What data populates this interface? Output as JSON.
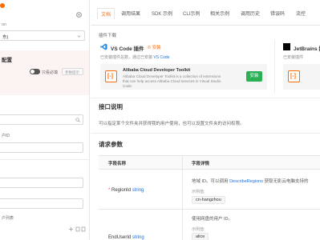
{
  "left": {
    "line1": "on",
    "select_value": "东)",
    "section_title": "配置",
    "toggle_label": "只看必填",
    "small_btn": "参数提示",
    "uid_label": "户ID",
    "list_label": "户列表"
  },
  "tabs": [
    "文档",
    "调用结果",
    "SDK 示例",
    "CLI示例",
    "相关示例",
    "调用历史",
    "错误码",
    "流控"
  ],
  "plugins": {
    "title": "插件下载",
    "vscode": {
      "name": "VS Code 插件",
      "tag": "© 安装",
      "installed_prefix": "已安装插件总数，通过已安装",
      "installed_highlight": "VS Code",
      "plugin_name": "Alibaba Cloud Developer Toolkit",
      "plugin_desc": "Alibaba Cloud Developer Toolkit is a collection of extensions that can help access Alibaba Cloud services in Visual Studio Code.",
      "install_label": "安装"
    },
    "jetbrains": {
      "name": "JetBrains 插件",
      "installed_prefix": "已安装插件"
    }
  },
  "api_desc": {
    "title": "接口说明",
    "text": "可以指定某个文件夹并获得我的用户使用，也可以设置文件夹的访问权限。"
  },
  "params": {
    "title": "请求参数",
    "col_name": "字段名称",
    "col_detail": "字段详情",
    "rows": [
      {
        "required": "*",
        "name": "RegionId",
        "type": "string",
        "desc_prefix": "地域 ID。可以调用 ",
        "desc_link": "DescribeRegions",
        "desc_suffix": " 获取无影云电脑支持的",
        "example_label": "示例值:",
        "example": "cn-hangzhou"
      },
      {
        "required": "",
        "name": "EndUserId",
        "type": "string",
        "desc_prefix": "使用网盘的用户 ID。",
        "desc_link": "",
        "desc_suffix": "",
        "example_label": "示例值:",
        "example": "alice"
      }
    ]
  }
}
